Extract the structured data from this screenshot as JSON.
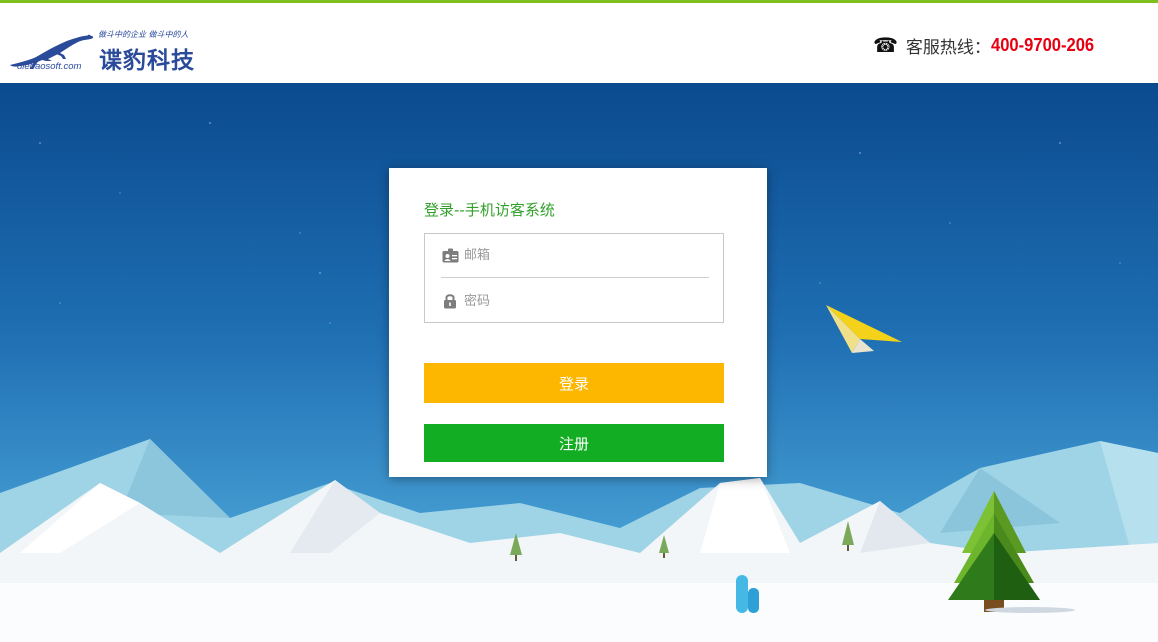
{
  "header": {
    "logo": {
      "slogan": "做斗中的企业 做斗中的人",
      "name": "谍豹科技",
      "domain": "diebaosoft.com"
    },
    "hotline": {
      "icon": "phone-icon",
      "label": "客服热线：",
      "number": "400-9700-206",
      "number_color": "#e60012"
    },
    "accent_color": "#7fbf1f"
  },
  "login": {
    "title": "登录--手机访客系统",
    "email": {
      "icon": "id-card-icon",
      "placeholder": "邮箱",
      "value": ""
    },
    "password": {
      "icon": "lock-icon",
      "placeholder": "密码",
      "value": ""
    },
    "login_label": "登录",
    "register_label": "注册",
    "colors": {
      "title": "#33a02c",
      "login_button": "#fdb700",
      "register_button": "#12ad22"
    }
  }
}
